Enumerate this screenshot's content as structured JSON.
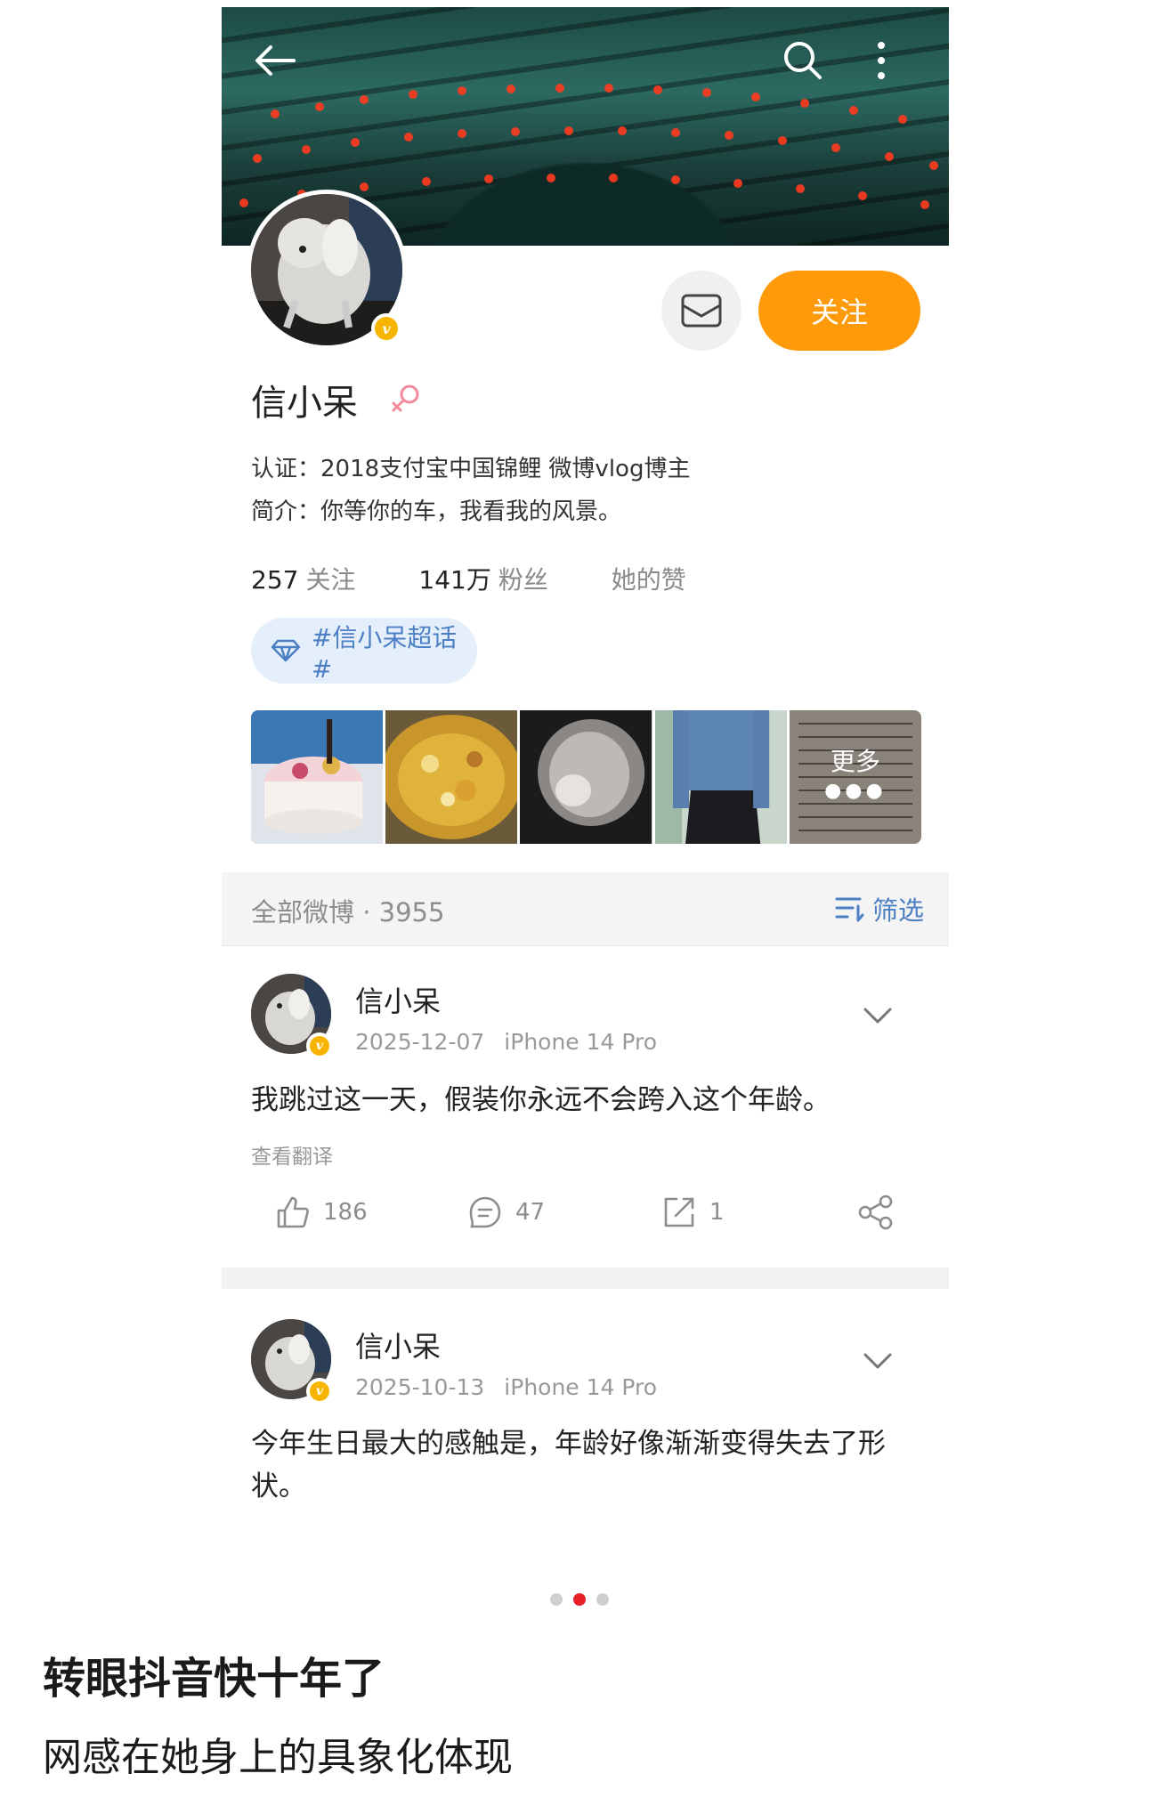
{
  "profile": {
    "name": "信小呆",
    "verify_text": "认证：2018支付宝中国锦鲤  微博vlog博主",
    "bio_text": "简介：你等你的车，我看我的风景。",
    "follow_label": "关注",
    "stats": [
      {
        "num": "257",
        "label": "关注"
      },
      {
        "num": "141万",
        "label": "粉丝"
      },
      {
        "num": "",
        "label": "她的赞"
      }
    ],
    "topic_label": "#信小呆超话#",
    "more_label": "更多"
  },
  "feed": {
    "count_text": "全部微博 · 3955",
    "filter_label": "筛选"
  },
  "posts": [
    {
      "name": "信小呆",
      "date": "2025-12-07",
      "device": "iPhone 14 Pro",
      "text": "我跳过这一天，假装你永远不会跨入这个年龄。",
      "translate": "查看翻译",
      "likes": "186",
      "comments": "47",
      "reposts": "1"
    },
    {
      "name": "信小呆",
      "date": "2025-10-13",
      "device": "iPhone 14 Pro",
      "text": "今年生日最大的感触是，年龄好像渐渐变得失去了形状。"
    }
  ],
  "pagination": {
    "total": 3,
    "active_index": 1
  },
  "caption": {
    "line1": "转眼抖音快十年了",
    "line2": "网感在她身上的具象化体现"
  },
  "colors": {
    "accent_orange": "#ff9a0a",
    "link_blue": "#4c7fc4",
    "verified_gold": "#f7b500",
    "active_dot": "#e8202a"
  },
  "icons": [
    "back-arrow-icon",
    "search-icon",
    "more-vertical-icon",
    "message-icon",
    "female-icon",
    "diamond-icon",
    "filter-icon",
    "chevron-down-icon",
    "like-icon",
    "comment-icon",
    "repost-icon",
    "share-icon"
  ]
}
